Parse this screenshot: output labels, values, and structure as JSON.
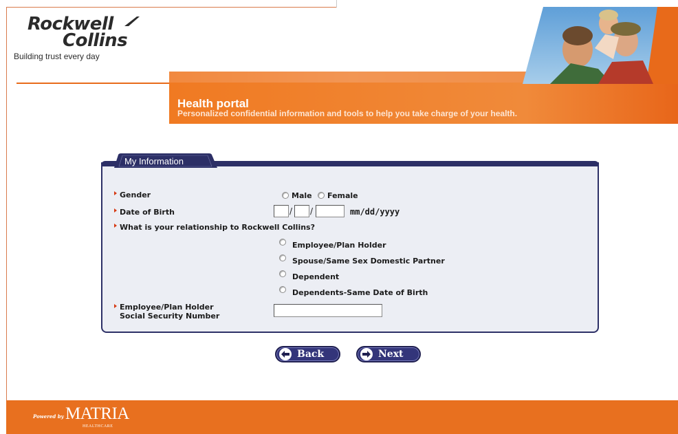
{
  "brand": {
    "name_line1": "Rockwell",
    "name_line2": "Collins",
    "tagline": "Building trust every day",
    "accent_color": "#e86a1a",
    "navy_color": "#2c2f66"
  },
  "header": {
    "title": "Health portal",
    "subtitle": "Personalized confidential information and tools to help you take charge of your health."
  },
  "form": {
    "section_title": "My Information",
    "gender": {
      "label": "Gender",
      "options": [
        "Male",
        "Female"
      ]
    },
    "dob": {
      "label": "Date of Birth",
      "separator": "/",
      "format_hint": "mm/dd/yyyy",
      "month": "",
      "day": "",
      "year": ""
    },
    "relationship": {
      "label": "What is your relationship to Rockwell Collins?",
      "options": [
        "Employee/Plan Holder",
        "Spouse/Same Sex Domestic Partner",
        "Dependent",
        "Dependents-Same Date of Birth"
      ]
    },
    "ssn": {
      "label_line1": "Employee/Plan Holder",
      "label_line2": "Social Security Number",
      "value": ""
    }
  },
  "nav": {
    "back_label": "Back",
    "next_label": "Next"
  },
  "footer": {
    "powered_by": "Powered by",
    "vendor": "MATRIA",
    "vendor_sub": "HEALTHCARE"
  }
}
